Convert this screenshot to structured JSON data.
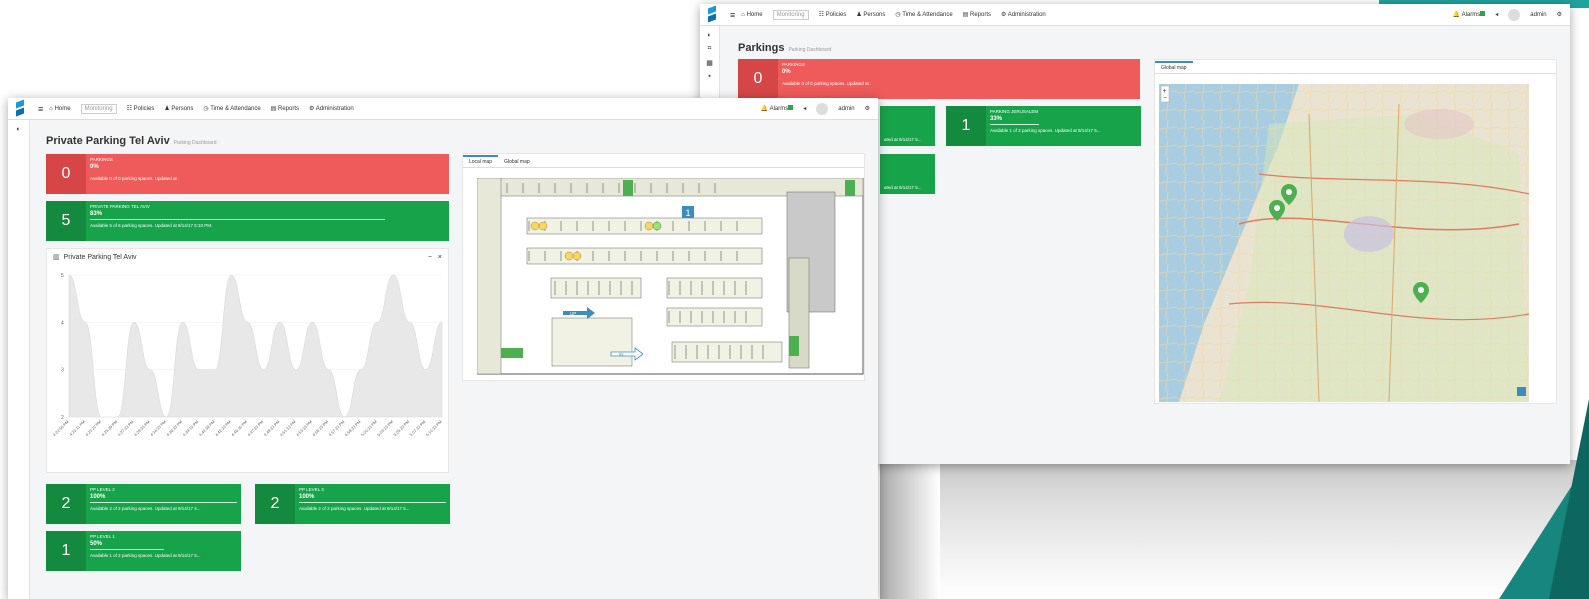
{
  "back": {
    "nav": [
      "Home",
      "Monitoring",
      "Policies",
      "Persons",
      "Time & Attendance",
      "Reports",
      "Administration"
    ],
    "right": {
      "alarms": "Alarms",
      "user": "admin"
    },
    "title": "Parkings",
    "subtitle": "Parking Dashboard",
    "tile_main": {
      "num": "0",
      "name": "PARKINGS",
      "pct": "0%",
      "avail": "Available 0 of 0 parking spaces. Updated at ."
    },
    "tile_jeru": {
      "num": "1",
      "name": "PARKING JERUSALEM",
      "pct": "33%",
      "avail": "Available 1 of 3 parking spaces. Updated at 9/14/17 5..."
    },
    "hidden_frag1": "ated at 9/14/17 5...",
    "hidden_frag2": "ated at 9/14/17 5...",
    "map_tab": "Global map"
  },
  "front": {
    "nav": [
      "Home",
      "Monitoring",
      "Policies",
      "Persons",
      "Time & Attendance",
      "Reports",
      "Administration"
    ],
    "right": {
      "alarms": "Alarms",
      "user": "admin"
    },
    "title": "Private Parking Tel Aviv",
    "subtitle": "Parking Dashboard",
    "tile_main": {
      "num": "0",
      "name": "PARKINGS",
      "pct": "0%",
      "avail": "Available 0 of 0 parking spaces. Updated at ."
    },
    "tile_tlv": {
      "num": "5",
      "name": "PRIVATE PARKING TEL AVIV",
      "pct": "83%",
      "avail": "Available 5 of 6 parking spaces. Updated at 9/14/17 5:10 PM."
    },
    "chart_title": "Private Parking Tel Aviv",
    "tabs": [
      "Local map",
      "Global map"
    ],
    "lvl2": {
      "num": "2",
      "name": "PP LEVEL 2",
      "pct": "100%",
      "avail": "Available 2 of 2 parking spaces. Updated at 9/14/17 4..."
    },
    "lvl3": {
      "num": "2",
      "name": "PP LEVEL 3",
      "pct": "100%",
      "avail": "Available 2 of 2 parking spaces. Updated at 9/14/17 5..."
    },
    "lvl1": {
      "num": "1",
      "name": "PP LEVEL 1",
      "pct": "50%",
      "avail": "Available 1 of 2 parking spaces. Updated at 9/14/17 5..."
    },
    "floor_labels": {
      "up": "UP",
      "in": "IN",
      "one": "1"
    }
  },
  "chart_data": {
    "type": "area",
    "title": "Private Parking Tel Aviv",
    "x": [
      "4:22:55 PM",
      "4:23:11 PM",
      "4:23:22 PM",
      "4:25:39 PM",
      "4:27:33 PM",
      "4:29:35 PM",
      "4:34:33 PM",
      "4:36:33 PM",
      "4:39:15 PM",
      "4:40:38 PM",
      "4:42:33 PM",
      "4:46:30 PM",
      "4:47:33 PM",
      "4:48:33 PM",
      "4:51:33 PM",
      "4:53:33 PM",
      "4:56:33 PM",
      "4:57:33 PM",
      "4:58:33 PM",
      "5:00:33 PM",
      "5:03:33 PM",
      "5:05:33 PM",
      "5:07:33 PM",
      "5:10:33 PM"
    ],
    "values": [
      5,
      4,
      2,
      2,
      4,
      3,
      2,
      4,
      3,
      3,
      5,
      4,
      3,
      4,
      3,
      4,
      3,
      2,
      3,
      4,
      5,
      4,
      3,
      4
    ],
    "ylim": [
      2,
      5
    ],
    "yticks": [
      "5",
      "4",
      "3",
      "2"
    ],
    "color": "#e8e8e8"
  },
  "colors": {
    "red": "#ef5b5b",
    "green": "#16a34a",
    "accent": "#3c8dbc"
  }
}
